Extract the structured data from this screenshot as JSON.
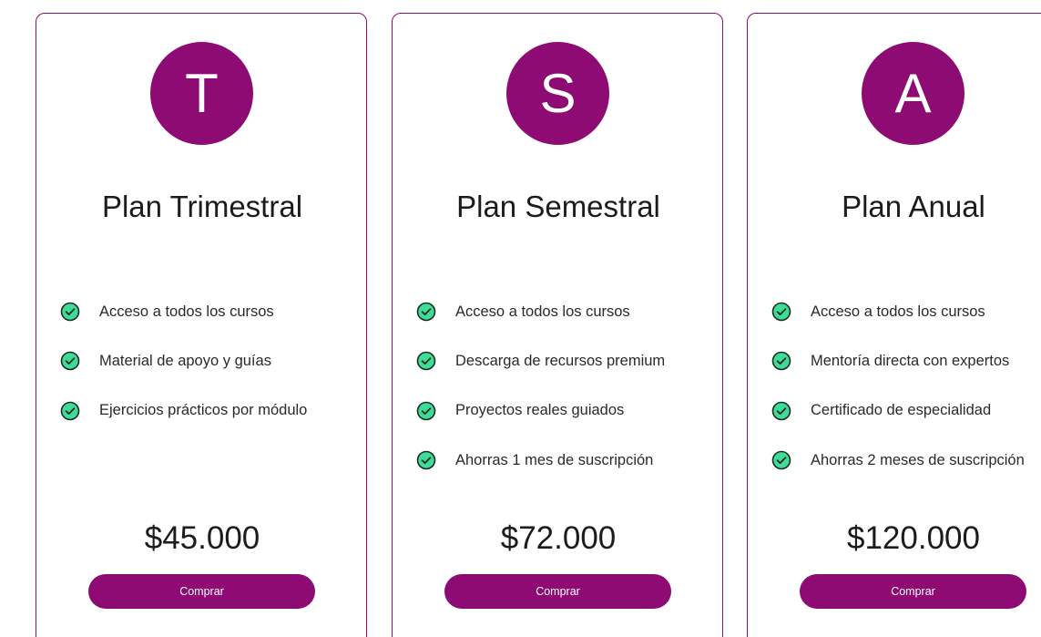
{
  "colors": {
    "accent": "#8e0b73",
    "check_fill": "#3ddc97",
    "check_stroke": "#1b2b22"
  },
  "plans": [
    {
      "initial": "T",
      "title": "Plan Trimestral",
      "features": [
        "Acceso a todos los cursos",
        "Material de apoyo y guías",
        "Ejercicios prácticos por módulo"
      ],
      "price": "$45.000",
      "button_label": "Comprar"
    },
    {
      "initial": "S",
      "title": "Plan Semestral",
      "features": [
        "Acceso a todos los cursos",
        "Descarga de recursos premium",
        "Proyectos reales guiados",
        "Ahorras 1 mes de suscripción"
      ],
      "price": "$72.000",
      "button_label": "Comprar"
    },
    {
      "initial": "A",
      "title": "Plan Anual",
      "features": [
        "Acceso a todos los cursos",
        "Mentoría directa con expertos",
        "Certificado de especialidad",
        "Ahorras 2 meses de suscripción"
      ],
      "price": "$120.000",
      "button_label": "Comprar"
    }
  ]
}
